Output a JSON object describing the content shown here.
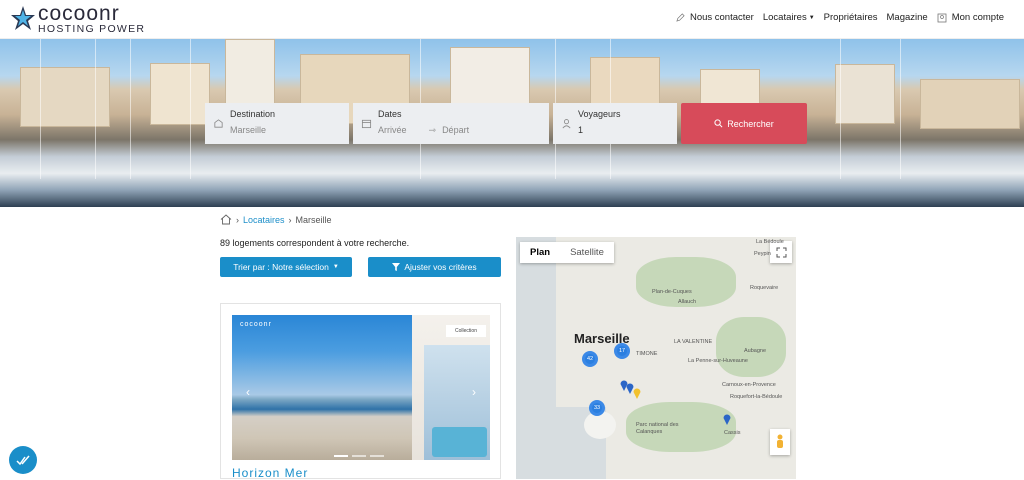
{
  "header": {
    "logo_name": "cocoonr",
    "logo_tagline": "HOSTING POWER",
    "nav": {
      "contact": "Nous contacter",
      "tenants": "Locataires",
      "owners": "Propriétaires",
      "magazine": "Magazine",
      "account": "Mon compte"
    }
  },
  "search": {
    "destination_label": "Destination",
    "destination_value": "Marseille",
    "dates_label": "Dates",
    "arrival_placeholder": "Arrivée",
    "departure_placeholder": "Départ",
    "travelers_label": "Voyageurs",
    "travelers_value": "1",
    "submit_label": "Rechercher"
  },
  "breadcrumb": {
    "level1": "Locataires",
    "level2": "Marseille"
  },
  "results": {
    "count_text": "89 logements correspondent à votre recherche.",
    "sort_label": "Trier par : Notre sélection",
    "filter_label": "Ajuster vos critères"
  },
  "listing": {
    "title": "Horizon Mer",
    "image_logo": "cocoonr",
    "badge_text": "Collection"
  },
  "map": {
    "tab_plan": "Plan",
    "tab_satellite": "Satellite",
    "city": "Marseille",
    "labels": {
      "allauch": "Allauch",
      "plan_de_cuques": "Plan-de-Cuques",
      "la_valentine": "LA VALENTINE",
      "la_penne": "La Penne-sur-Huveaune",
      "aubagne": "Aubagne",
      "carnoux": "Carnoux-en-Provence",
      "roquefort": "Roquefort-la-Bédoule",
      "cassis": "Cassis",
      "calanques": "Parc national des Calanques",
      "roquevaire": "Roquevaire",
      "peypin": "Peypin",
      "la_bedoule": "La Bédoule",
      "timone": "TIMONE"
    },
    "clusters": [
      "42",
      "17",
      "33"
    ]
  },
  "colors": {
    "accent": "#1a8ec9",
    "search_button": "#d74b5a"
  }
}
